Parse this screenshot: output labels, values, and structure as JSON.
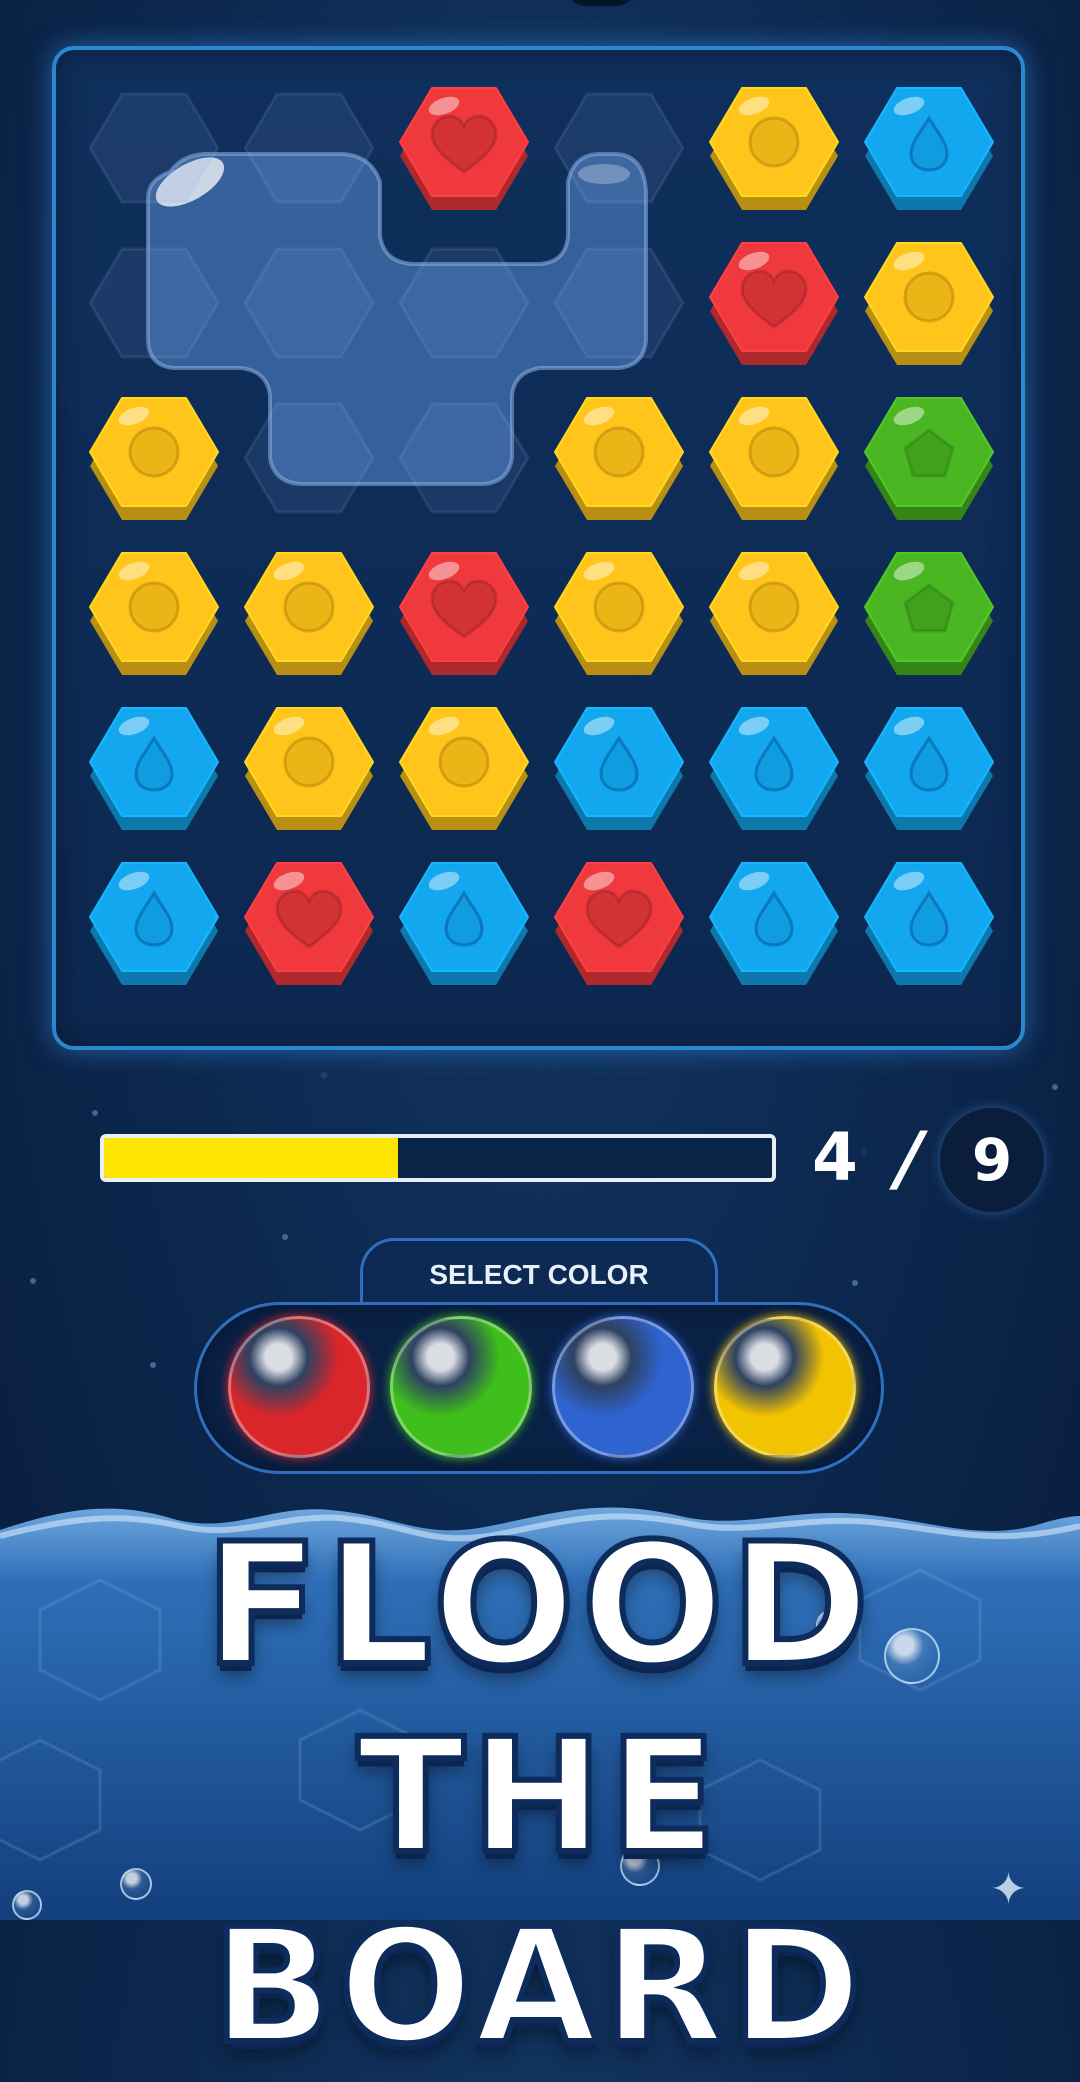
{
  "colors": {
    "red": "#f0393c",
    "yellow": "#ffc51a",
    "blue": "#12a7ef",
    "green": "#4ab722",
    "flood": "#3d6aa6",
    "progress_fill": "#ffe600",
    "board_border": "#2b88d0"
  },
  "board": {
    "rows": 6,
    "cols": 6,
    "grid": [
      [
        "flood",
        "flood",
        "red",
        "flood",
        "yellow",
        "blue"
      ],
      [
        "flood",
        "flood",
        "flood",
        "flood",
        "red",
        "yellow"
      ],
      [
        "yellow",
        "flood",
        "flood",
        "yellow",
        "yellow",
        "green"
      ],
      [
        "yellow",
        "yellow",
        "red",
        "yellow",
        "yellow",
        "green"
      ],
      [
        "blue",
        "yellow",
        "yellow",
        "blue",
        "blue",
        "blue"
      ],
      [
        "blue",
        "red",
        "blue",
        "red",
        "blue",
        "blue"
      ]
    ],
    "symbols": {
      "red": "heart-icon",
      "yellow": "circle-icon",
      "blue": "drop-icon",
      "green": "pentagon-icon"
    }
  },
  "progress": {
    "current": "4",
    "separator": "/",
    "total": "9",
    "fraction": 0.44
  },
  "palette": {
    "label": "SELECT COLOR",
    "options": [
      {
        "name": "red",
        "color": "#d8262b"
      },
      {
        "name": "green",
        "color": "#3fbf1b"
      },
      {
        "name": "blue",
        "color": "#2f63cf"
      },
      {
        "name": "yellow",
        "color": "#f2c300"
      }
    ]
  },
  "title": {
    "line1": "FLOOD",
    "line2": "THE BOARD"
  }
}
